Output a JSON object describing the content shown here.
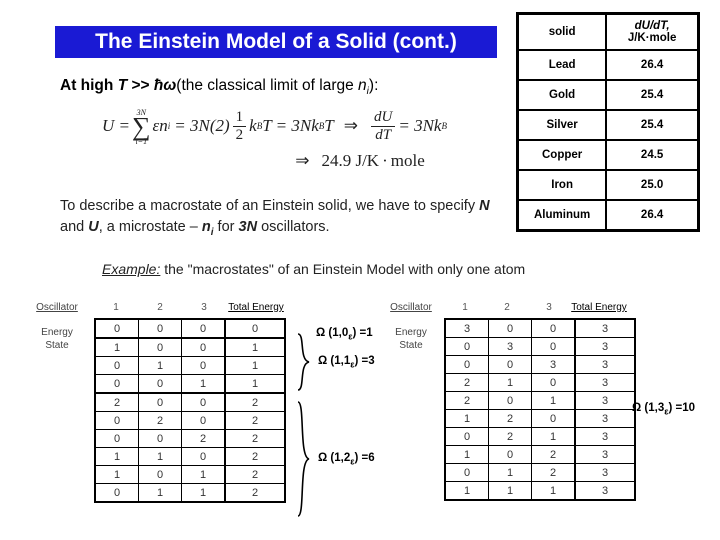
{
  "slide": {
    "title": "The Einstein Model of a Solid (cont.)",
    "title_bg": "#1a1ad4",
    "title_color": "#ffffff"
  },
  "high_t": {
    "prefix": "At high ",
    "var_T": "T",
    "gtgt": " >> ",
    "hbar_omega": "ħω",
    "rest": "(the classical limit of large ",
    "n_var": "n",
    "n_sub": "i",
    "tail": "):"
  },
  "formula": {
    "line1": {
      "u_eq": "U =",
      "sigma_upper": "3N",
      "sigma": "∑",
      "sigma_lower": "i=1",
      "eps": "ε",
      "n_i": "n",
      "n_i_sub": "i",
      "eq2": "= 3N(2)",
      "frac_num": "1",
      "frac_den": "2",
      "kbt": "k",
      "kb_sub": "B",
      "t1": "T",
      "eq3": "= 3Nk",
      "kb_sub2": "B",
      "t2": "T",
      "implies": "⇒",
      "du_num": "dU",
      "du_den": "dT",
      "eq4": "= 3Nk",
      "kb_sub3": "B"
    },
    "line2": {
      "implies": "⇒",
      "value": "24.9 J/K",
      "dot": "·",
      "unit": "mole"
    }
  },
  "macrostate": {
    "part1": "To describe a macrostate of an Einstein solid, we have to specify ",
    "N1": "N",
    "part2": " and ",
    "U1": "U",
    "part3": ", a microstate – ",
    "n_var": "n",
    "n_sub": "i",
    "part4": " for ",
    "threeN": "3N",
    "part5": " oscillators."
  },
  "example": {
    "label": "Example:",
    "text": "the \"macrostates\" of an Einstein Model with only one atom"
  },
  "solids_table": {
    "header": {
      "col1": "solid",
      "col2_line1": "dU/dT,",
      "col2_line2": "J/K·mole"
    },
    "rows": [
      {
        "solid": "Lead",
        "value": "26.4"
      },
      {
        "solid": "Gold",
        "value": "25.4"
      },
      {
        "solid": "Silver",
        "value": "25.4"
      },
      {
        "solid": "Copper",
        "value": "24.5"
      },
      {
        "solid": "Iron",
        "value": "25.0"
      },
      {
        "solid": "Aluminum",
        "value": "26.4"
      }
    ]
  },
  "micro_left": {
    "osc_label": "Oscillator",
    "energy_state_line1": "Energy",
    "energy_state_line2": "State",
    "headers": [
      "1",
      "2",
      "3",
      "Total Energy"
    ],
    "rows": [
      [
        "0",
        "0",
        "0",
        "0"
      ],
      [
        "1",
        "0",
        "0",
        "1"
      ],
      [
        "0",
        "1",
        "0",
        "1"
      ],
      [
        "0",
        "0",
        "1",
        "1"
      ],
      [
        "2",
        "0",
        "0",
        "2"
      ],
      [
        "0",
        "2",
        "0",
        "2"
      ],
      [
        "0",
        "0",
        "2",
        "2"
      ],
      [
        "1",
        "1",
        "0",
        "2"
      ],
      [
        "1",
        "0",
        "1",
        "2"
      ],
      [
        "0",
        "1",
        "1",
        "2"
      ]
    ],
    "group_ends": [
      0,
      3,
      9
    ],
    "omega_labels": [
      {
        "text": "Ω (1,0",
        "eps": "ε",
        "tail": ") =1"
      },
      {
        "text": "Ω (1,1",
        "eps": "ε",
        "tail": ") =3"
      },
      {
        "text": "Ω (1,2",
        "eps": "ε",
        "tail": ") =6"
      }
    ]
  },
  "micro_right": {
    "osc_label": "Oscillator",
    "energy_state_line1": "Energy",
    "energy_state_line2": "State",
    "headers": [
      "1",
      "2",
      "3",
      "Total Energy"
    ],
    "rows": [
      [
        "3",
        "0",
        "0",
        "3"
      ],
      [
        "0",
        "3",
        "0",
        "3"
      ],
      [
        "0",
        "0",
        "3",
        "3"
      ],
      [
        "2",
        "1",
        "0",
        "3"
      ],
      [
        "2",
        "0",
        "1",
        "3"
      ],
      [
        "1",
        "2",
        "0",
        "3"
      ],
      [
        "0",
        "2",
        "1",
        "3"
      ],
      [
        "1",
        "0",
        "2",
        "3"
      ],
      [
        "0",
        "1",
        "2",
        "3"
      ],
      [
        "1",
        "1",
        "1",
        "3"
      ]
    ],
    "omega_labels": [
      {
        "text": "Ω (1,3",
        "eps": "ε",
        "tail": ") =10"
      }
    ]
  }
}
